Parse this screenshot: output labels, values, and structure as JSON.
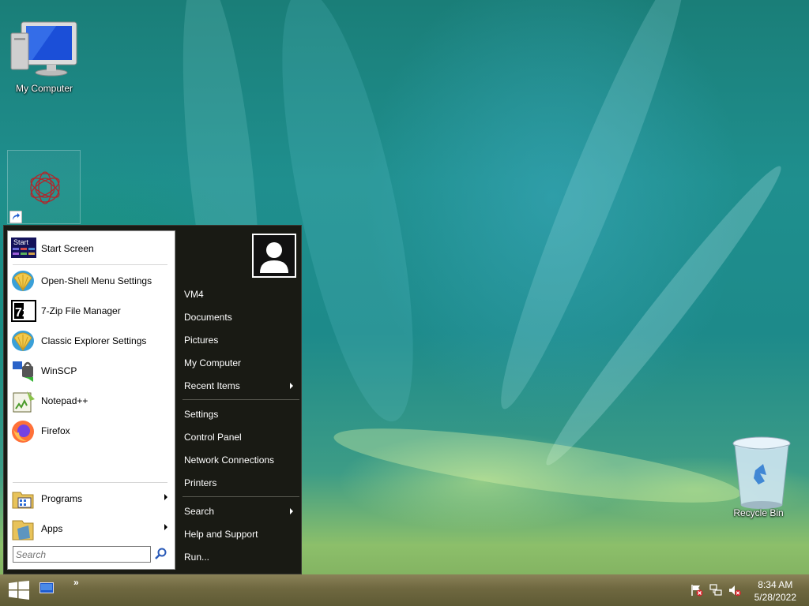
{
  "desktop": {
    "icons": {
      "my_computer": "My Computer",
      "recycle_bin": "Recycle Bin"
    }
  },
  "start_menu": {
    "pinned": [
      {
        "label": "Start Screen",
        "icon": "start-screen-icon"
      },
      {
        "label": "Open-Shell Menu Settings",
        "icon": "shell-icon"
      },
      {
        "label": "7-Zip File Manager",
        "icon": "7zip-icon"
      },
      {
        "label": "Classic Explorer Settings",
        "icon": "shell-icon"
      },
      {
        "label": "WinSCP",
        "icon": "winscp-icon"
      },
      {
        "label": "Notepad++",
        "icon": "notepadpp-icon"
      },
      {
        "label": "Firefox",
        "icon": "firefox-icon"
      }
    ],
    "programs": "Programs",
    "apps": "Apps",
    "search_placeholder": "Search",
    "right": {
      "vm4": "VM4",
      "documents": "Documents",
      "pictures": "Pictures",
      "my_computer": "My Computer",
      "recent_items": "Recent Items",
      "settings": "Settings",
      "control_panel": "Control Panel",
      "network_connections": "Network Connections",
      "printers": "Printers",
      "search": "Search",
      "help_and_support": "Help and Support",
      "run": "Run..."
    },
    "start_screen_icon_text": "Start",
    "seven_zip_icon_text": "7z"
  },
  "taskbar": {
    "chevron": "»",
    "time": "8:34 AM",
    "date": "5/28/2022"
  }
}
